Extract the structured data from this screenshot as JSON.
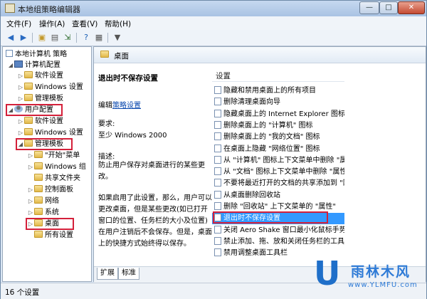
{
  "window": {
    "title": "本地组策略编辑器",
    "min": "—",
    "max": "□",
    "close": "✕"
  },
  "menu": [
    "文件(F)",
    "操作(A)",
    "查看(V)",
    "帮助(H)"
  ],
  "tree": {
    "items": [
      {
        "label": "本地计算机 策略"
      },
      {
        "label": "计算机配置"
      },
      {
        "label": "软件设置"
      },
      {
        "label": "Windows 设置"
      },
      {
        "label": "管理模板"
      },
      {
        "label": "用户配置"
      },
      {
        "label": "软件设置"
      },
      {
        "label": "Windows 设置"
      },
      {
        "label": "管理模板"
      },
      {
        "label": "\"开始\"菜单"
      },
      {
        "label": "Windows 组"
      },
      {
        "label": "共享文件夹"
      },
      {
        "label": "控制面板"
      },
      {
        "label": "网络"
      },
      {
        "label": "系统"
      },
      {
        "label": "桌面"
      },
      {
        "label": "所有设置"
      }
    ]
  },
  "content": {
    "header": "桌面",
    "desc": {
      "title": "退出时不保存设置",
      "edit_prefix": "编辑",
      "edit_link": "策略设置",
      "req_label": "要求:",
      "req_value": "至少 Windows 2000",
      "desc_label": "描述:",
      "desc_text": "防止用户保存对桌面进行的某些更改。",
      "detail": "如果启用了此设置，那么，用户可以更改桌面，但是某些更改(如已打开窗口的位置、任务栏的大小及位置)在用户注销后不会保存。但是，桌面上的快捷方式始终得以保存。"
    },
    "list_header": "设置",
    "rows": [
      "隐藏和禁用桌面上的所有项目",
      "删除清理桌面向导",
      "隐藏桌面上的 Internet Explorer 图标",
      "删除桌面上的 \"计算机\" 图标",
      "删除桌面上的 \"我的文档\" 图标",
      "在桌面上隐藏 \"网络位置\" 图标",
      "从 \"计算机\" 图标上下文菜单中删除 \"属性\"",
      "从 \"文档\" 图标上下文菜单中删除 \"属性\"",
      "不要将最近打开的文档的共享添加到 \"网络位置\"",
      "从桌面删除回收站",
      "删除 \"回收站\" 上下文菜单的 \"属性\"",
      "退出时不保存设置",
      "关闭 Aero Shake 窗口最小化鼠标手势",
      "禁止添加、拖、放和关闭任务栏的工具栏",
      "禁用调整桌面工具栏"
    ],
    "selected_row": 11,
    "tabs": [
      "扩展",
      "标准"
    ]
  },
  "status": "16 个设置",
  "watermark": {
    "letter": "U",
    "name": "雨林木风",
    "url": "www.YLMFU.com"
  },
  "colors": {
    "selection": "#3399ff",
    "highlight_box": "#d4203a"
  }
}
